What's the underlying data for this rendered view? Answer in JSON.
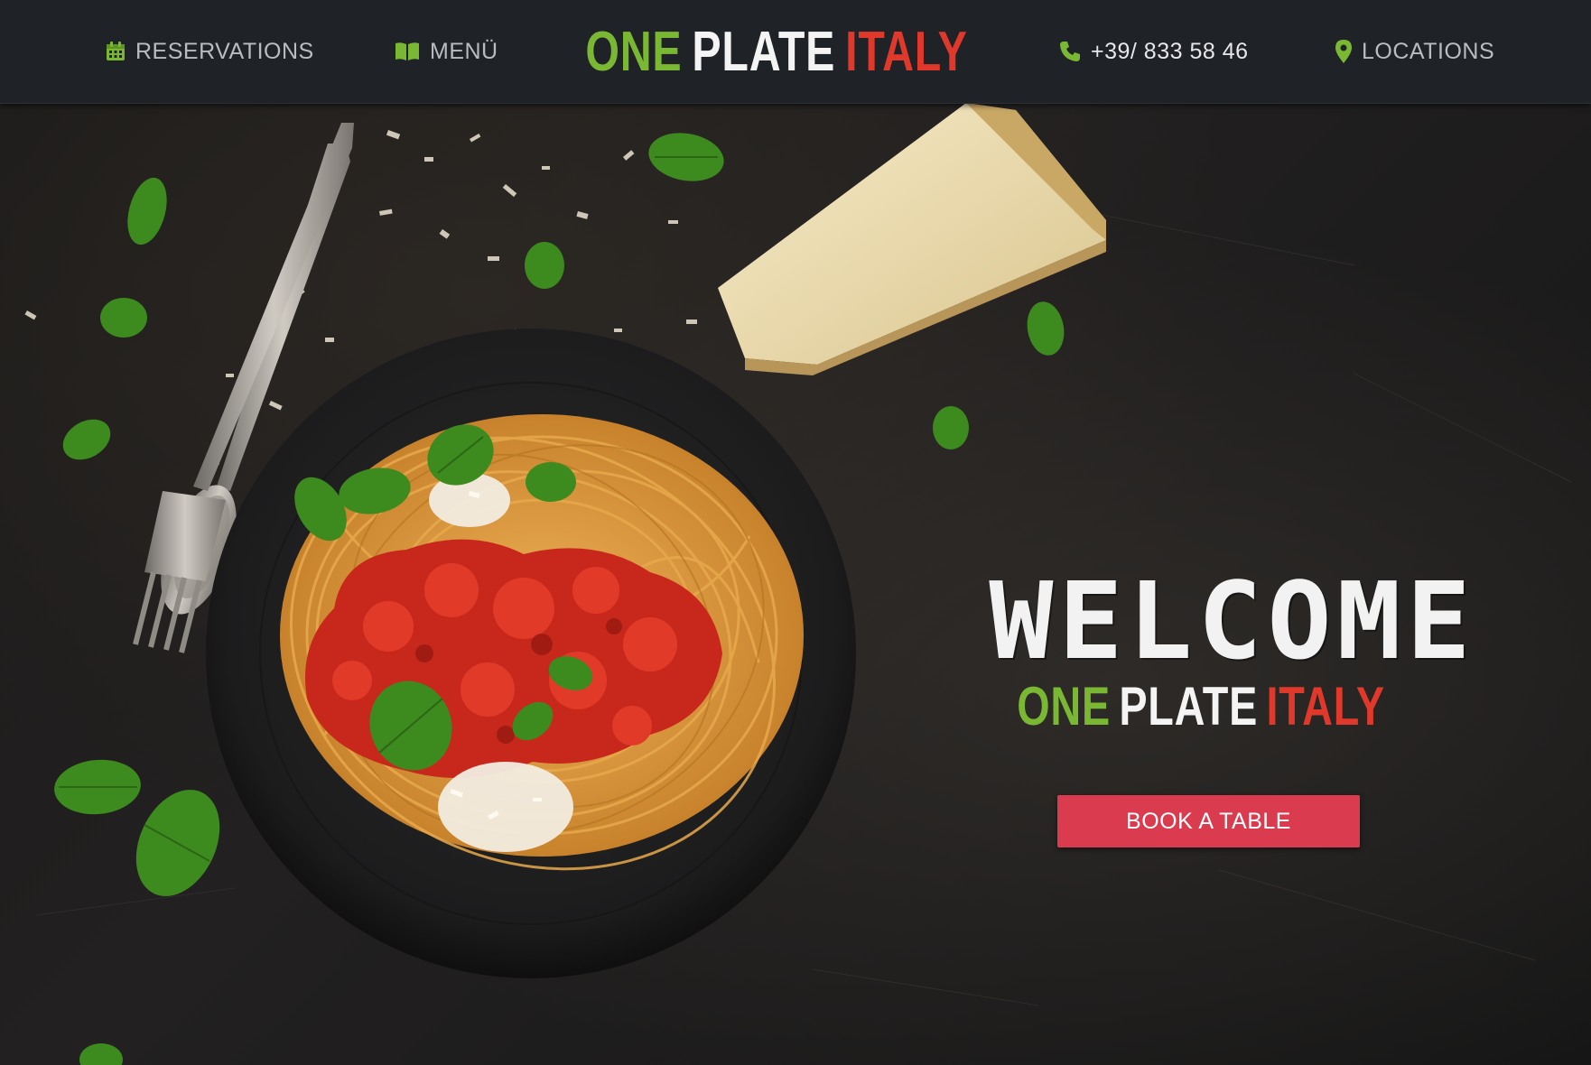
{
  "header": {
    "nav_left": [
      {
        "label": "RESERVATIONS",
        "icon": "calendar-icon"
      },
      {
        "label": "MENÜ",
        "icon": "book-icon"
      }
    ],
    "logo": {
      "word1": "ONE",
      "word2": "PLATE",
      "word3": "ITALY"
    },
    "nav_right": [
      {
        "label": "+39/ 833 58 46",
        "icon": "phone-icon"
      },
      {
        "label": "LOCATIONS",
        "icon": "map-pin-icon"
      }
    ]
  },
  "hero": {
    "welcome": "WELCOME",
    "brand": {
      "word1": "ONE",
      "word2": "PLATE",
      "word3": "ITALY"
    },
    "cta_label": "BOOK A TABLE",
    "image": "spaghetti-plate-photo"
  },
  "colors": {
    "header_bg": "#1f2226",
    "green": "#7ab833",
    "white": "#f4f4f4",
    "red": "#e0392b",
    "cta": "#db3b4f"
  }
}
